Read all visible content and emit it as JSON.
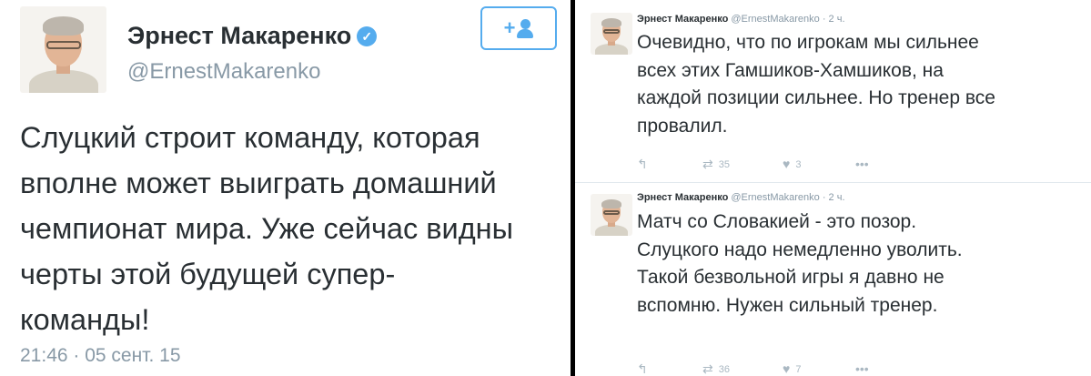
{
  "left_tweet": {
    "author_name": "Эрнест Макаренко",
    "verified_mark": "✓",
    "handle": "@ErnestMakarenko",
    "follow_label": "+",
    "text": "Слуцкий строит команду, которая\nвполне может выиграть домашний\nчемпионат мира. Уже сейчас видны\nчерты этой будущей супер-\nкоманды!",
    "timestamp": "21:46 · 05 сент. 15"
  },
  "right_tweets": [
    {
      "author_name": "Эрнест Макаренко",
      "handle": "@ErnestMakarenko",
      "time": "· 2 ч.",
      "text": "Очевидно, что по игрокам мы сильнее\nвсех этих Гамшиков-Хамшиков, на\nкаждой позиции сильнее. Но тренер все\nпровалил.",
      "reply_icon": "↰",
      "retweet_icon": "⇄",
      "retweets": "35",
      "like_icon": "♥",
      "likes": "3",
      "more_icon": "•••"
    },
    {
      "author_name": "Эрнест Макаренко",
      "handle": "@ErnestMakarenko",
      "time": "· 2 ч.",
      "text": "Матч со Словакией - это позор.\nСлуцкого надо немедленно уволить.\nТакой безвольной игры я давно не\nвспомню. Нужен сильный тренер.",
      "reply_icon": "↰",
      "retweet_icon": "⇄",
      "retweets": "36",
      "like_icon": "♥",
      "likes": "7",
      "more_icon": "•••"
    }
  ],
  "icons": {
    "verified": "verified-badge-icon",
    "follow": "add-user-icon",
    "reply": "reply-icon",
    "retweet": "retweet-icon",
    "like": "like-icon",
    "more": "more-icon"
  },
  "colors": {
    "accent": "#55acee",
    "text": "#292f33",
    "muted": "#8899a6",
    "action": "#aab8c2",
    "divider": "#000000"
  }
}
